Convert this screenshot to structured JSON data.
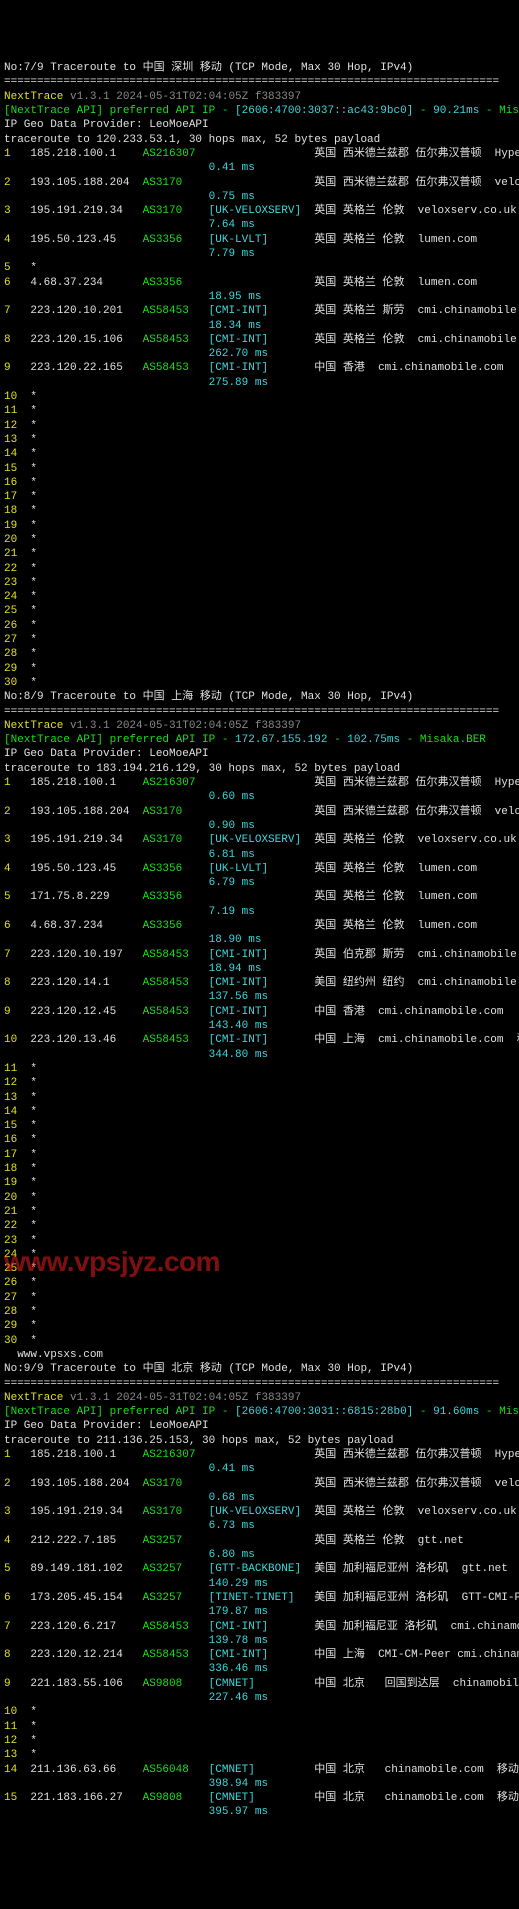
{
  "watermark": "www.vpsjyz.com",
  "sections": [
    {
      "title": "No:7/9 Traceroute to 中国 深圳 移动 (TCP Mode, Max 30 Hop, IPv4)",
      "hr": "===========================================================================",
      "nexttrace": "NextTrace v1.3.1 2024-05-31T02:04:05Z f383397",
      "api_pre": "[NextTrace API] preferred API IP - ",
      "api_ip": "[2606:4700:3037::ac43:9bc0]",
      "api_mid": " - ",
      "api_lat": "90.21ms",
      "api_suf": " - Misaka.BER",
      "geo": "IP Geo Data Provider: LeoMoeAPI",
      "trace_to": "traceroute to 120.233.53.1, 30 hops max, 52 bytes payload",
      "hops": [
        {
          "n": "1",
          "ip": "185.218.100.1",
          "as": "AS216307",
          "tag": "",
          "loc": "英国 西米德兰兹郡 伍尔弗汉普顿",
          "host": "  Hyperhost Solutions Limited",
          "lat": "0.41 ms"
        },
        {
          "n": "2",
          "ip": "193.105.188.204",
          "as": "AS3170",
          "tag": "",
          "loc": "英国 西米德兰兹郡 伍尔弗汉普顿",
          "host": "  veloxserv.co.uk",
          "lat": "0.75 ms"
        },
        {
          "n": "3",
          "ip": "195.191.219.34",
          "as": "AS3170",
          "tag": "[UK-VELOXSERV]",
          "loc": "英国 英格兰 伦敦",
          "host": "  veloxserv.co.uk",
          "lat": "7.64 ms"
        },
        {
          "n": "4",
          "ip": "195.50.123.45",
          "as": "AS3356",
          "tag": "[UK-LVLT]",
          "loc": "英国 英格兰 伦敦",
          "host": "  lumen.com",
          "lat": "7.79 ms"
        },
        {
          "n": "5",
          "ip": "*",
          "as": "",
          "tag": "",
          "loc": "",
          "host": "",
          "lat": ""
        },
        {
          "n": "6",
          "ip": "4.68.37.234",
          "as": "AS3356",
          "tag": "",
          "loc": "英国 英格兰 伦敦",
          "host": "  lumen.com",
          "lat": "18.95 ms"
        },
        {
          "n": "7",
          "ip": "223.120.10.201",
          "as": "AS58453",
          "tag": "[CMI-INT]",
          "loc": "英国 英格兰 斯劳",
          "host": "  cmi.chinamobile.com  移动",
          "lat": "18.34 ms"
        },
        {
          "n": "8",
          "ip": "223.120.15.106",
          "as": "AS58453",
          "tag": "[CMI-INT]",
          "loc": "英国 英格兰 伦敦",
          "host": "  cmi.chinamobile.com  移动",
          "lat": "262.70 ms"
        },
        {
          "n": "9",
          "ip": "223.120.22.165",
          "as": "AS58453",
          "tag": "[CMI-INT]",
          "loc": "中国 香港",
          "host": "  cmi.chinamobile.com",
          "lat": "275.89 ms"
        }
      ],
      "stars_from": 10,
      "stars_to": 30
    },
    {
      "title": "No:8/9 Traceroute to 中国 上海 移动 (TCP Mode, Max 30 Hop, IPv4)",
      "hr": "===========================================================================",
      "nexttrace": "NextTrace v1.3.1 2024-05-31T02:04:05Z f383397",
      "api_pre": "[NextTrace API] preferred API IP - ",
      "api_ip": "172.67.155.192",
      "api_mid": " - ",
      "api_lat": "102.75ms",
      "api_suf": " - Misaka.BER",
      "geo": "IP Geo Data Provider: LeoMoeAPI",
      "trace_to": "traceroute to 183.194.216.129, 30 hops max, 52 bytes payload",
      "hops": [
        {
          "n": "1",
          "ip": "185.218.100.1",
          "as": "AS216307",
          "tag": "",
          "loc": "英国 西米德兰兹郡 伍尔弗汉普顿",
          "host": "  Hyperhost Solutions Limited",
          "lat": "0.60 ms"
        },
        {
          "n": "2",
          "ip": "193.105.188.204",
          "as": "AS3170",
          "tag": "",
          "loc": "英国 西米德兰兹郡 伍尔弗汉普顿",
          "host": "  veloxserv.co.uk",
          "lat": "0.90 ms"
        },
        {
          "n": "3",
          "ip": "195.191.219.34",
          "as": "AS3170",
          "tag": "[UK-VELOXSERV]",
          "loc": "英国 英格兰 伦敦",
          "host": "  veloxserv.co.uk",
          "lat": "6.81 ms"
        },
        {
          "n": "4",
          "ip": "195.50.123.45",
          "as": "AS3356",
          "tag": "[UK-LVLT]",
          "loc": "英国 英格兰 伦敦",
          "host": "  lumen.com",
          "lat": "6.79 ms"
        },
        {
          "n": "5",
          "ip": "171.75.8.229",
          "as": "AS3356",
          "tag": "",
          "loc": "英国 英格兰 伦敦",
          "host": "  lumen.com",
          "lat": "7.19 ms"
        },
        {
          "n": "6",
          "ip": "4.68.37.234",
          "as": "AS3356",
          "tag": "",
          "loc": "英国 英格兰 伦敦",
          "host": "  lumen.com",
          "lat": "18.90 ms"
        },
        {
          "n": "7",
          "ip": "223.120.10.197",
          "as": "AS58453",
          "tag": "[CMI-INT]",
          "loc": "英国 伯克郡 斯劳",
          "host": "  cmi.chinamobile.com  移动",
          "lat": "18.94 ms"
        },
        {
          "n": "8",
          "ip": "223.120.14.1",
          "as": "AS58453",
          "tag": "[CMI-INT]",
          "loc": "美国 纽约州 纽约",
          "host": "  cmi.chinamobile.com  移动",
          "lat": "137.56 ms"
        },
        {
          "n": "9",
          "ip": "223.120.12.45",
          "as": "AS58453",
          "tag": "[CMI-INT]",
          "loc": "中国 香港",
          "host": "  cmi.chinamobile.com",
          "lat": "143.40 ms"
        },
        {
          "n": "10",
          "ip": "223.120.13.46",
          "as": "AS58453",
          "tag": "[CMI-INT]",
          "loc": "中国 上海",
          "host": "  cmi.chinamobile.com  移动",
          "lat": "344.80 ms"
        }
      ],
      "stars_from": 11,
      "stars_to": 30,
      "footer": "  www.vpsxs.com"
    },
    {
      "title": "No:9/9 Traceroute to 中国 北京 移动 (TCP Mode, Max 30 Hop, IPv4)",
      "hr": "===========================================================================",
      "nexttrace": "NextTrace v1.3.1 2024-05-31T02:04:05Z f383397",
      "api_pre": "[NextTrace API] preferred API IP - ",
      "api_ip": "[2606:4700:3031::6815:28b0]",
      "api_mid": " - ",
      "api_lat": "91.60ms",
      "api_suf": " - Misaka.BER",
      "geo": "IP Geo Data Provider: LeoMoeAPI",
      "trace_to": "traceroute to 211.136.25.153, 30 hops max, 52 bytes payload",
      "hops": [
        {
          "n": "1",
          "ip": "185.218.100.1",
          "as": "AS216307",
          "tag": "",
          "loc": "英国 西米德兰兹郡 伍尔弗汉普顿",
          "host": "  Hyperhost Solutions Limited",
          "lat": "0.41 ms"
        },
        {
          "n": "2",
          "ip": "193.105.188.204",
          "as": "AS3170",
          "tag": "",
          "loc": "英国 西米德兰兹郡 伍尔弗汉普顿",
          "host": "  veloxserv.co.uk",
          "lat": "0.68 ms"
        },
        {
          "n": "3",
          "ip": "195.191.219.34",
          "as": "AS3170",
          "tag": "[UK-VELOXSERV]",
          "loc": "英国 英格兰 伦敦",
          "host": "  veloxserv.co.uk",
          "lat": "6.73 ms"
        },
        {
          "n": "4",
          "ip": "212.222.7.185",
          "as": "AS3257",
          "tag": "",
          "loc": "英国 英格兰 伦敦",
          "host": "  gtt.net",
          "lat": "6.80 ms"
        },
        {
          "n": "5",
          "ip": "89.149.181.102",
          "as": "AS3257",
          "tag": "[GTT-BACKBONE]",
          "loc": "美国 加利福尼亚州 洛杉矶",
          "host": "  gtt.net",
          "lat": "140.29 ms"
        },
        {
          "n": "6",
          "ip": "173.205.45.154",
          "as": "AS3257",
          "tag": "[TINET-TINET]",
          "loc": "美国 加利福尼亚州 洛杉矶",
          "host": "  GTT-CMI-PoP gtt.net",
          "lat": "179.87 ms"
        },
        {
          "n": "7",
          "ip": "223.120.6.217",
          "as": "AS58453",
          "tag": "[CMI-INT]",
          "loc": "美国 加利福尼亚 洛杉矶",
          "host": "  cmi.chinamobile.com  移动",
          "lat": "139.78 ms"
        },
        {
          "n": "8",
          "ip": "223.120.12.214",
          "as": "AS58453",
          "tag": "[CMI-INT]",
          "loc": "中国 上海",
          "host": "  CMI-CM-Peer cmi.chinamobile.com  移动",
          "lat": "336.46 ms"
        },
        {
          "n": "9",
          "ip": "221.183.55.106",
          "as": "AS9808",
          "tag": "[CMNET]",
          "loc": "中国 北京   回国到达层",
          "host": "  chinamobileltd.com  移动",
          "lat": "227.46 ms"
        },
        {
          "n": "10",
          "ip": "*",
          "as": "",
          "tag": "",
          "loc": "",
          "host": "",
          "lat": ""
        },
        {
          "n": "11",
          "ip": "*",
          "as": "",
          "tag": "",
          "loc": "",
          "host": "",
          "lat": ""
        },
        {
          "n": "12",
          "ip": "*",
          "as": "",
          "tag": "",
          "loc": "",
          "host": "",
          "lat": ""
        },
        {
          "n": "13",
          "ip": "*",
          "as": "",
          "tag": "",
          "loc": "",
          "host": "",
          "lat": ""
        },
        {
          "n": "14",
          "ip": "211.136.63.66",
          "as": "AS56048",
          "tag": "[CMNET]",
          "loc": "中国 北京",
          "host": "   chinamobile.com  移动",
          "lat": "398.94 ms"
        },
        {
          "n": "15",
          "ip": "221.183.166.27",
          "as": "AS9808",
          "tag": "[CMNET]",
          "loc": "中国 北京",
          "host": "   chinamobile.com  移动",
          "lat": "395.97 ms"
        }
      ],
      "stars_from": 0,
      "stars_to": 0
    }
  ]
}
